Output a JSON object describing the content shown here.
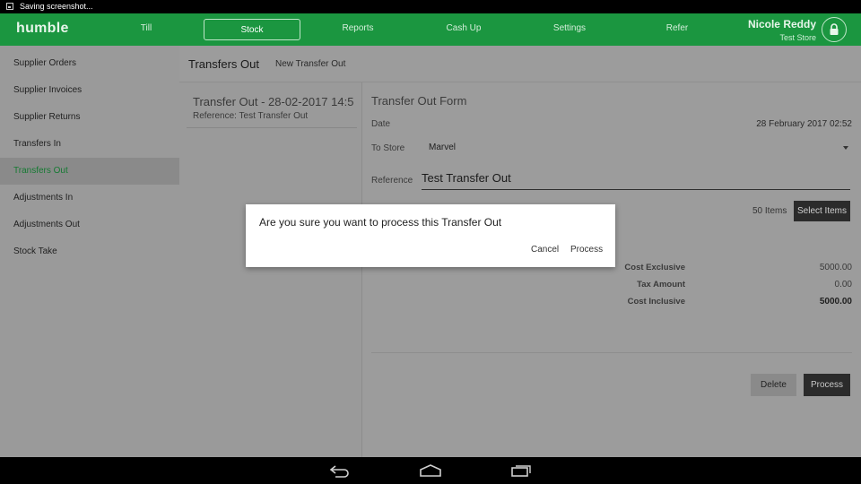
{
  "status_bar": {
    "text": "Saving screenshot..."
  },
  "topnav": {
    "brand": "humble",
    "items": [
      {
        "label": "Till"
      },
      {
        "label": "Stock"
      },
      {
        "label": "Reports"
      },
      {
        "label": "Cash Up"
      },
      {
        "label": "Settings"
      },
      {
        "label": "Refer"
      }
    ],
    "active": "Stock",
    "user_name": "Nicole Reddy",
    "store_name": "Test Store"
  },
  "sidebar": {
    "items": [
      {
        "label": "Supplier Orders"
      },
      {
        "label": "Supplier Invoices"
      },
      {
        "label": "Supplier Returns"
      },
      {
        "label": "Transfers In"
      },
      {
        "label": "Transfers Out"
      },
      {
        "label": "Adjustments In"
      },
      {
        "label": "Adjustments Out"
      },
      {
        "label": "Stock Take"
      }
    ],
    "active": "Transfers Out"
  },
  "main_header": {
    "title": "Transfers Out",
    "new_link": "New Transfer Out"
  },
  "list": {
    "items": [
      {
        "title": "Transfer Out - 28-02-2017 14:5",
        "reference": "Reference: Test Transfer Out"
      }
    ]
  },
  "form": {
    "title": "Transfer Out Form",
    "date_label": "Date",
    "date_value": "28 February 2017 02:52",
    "to_store_label": "To Store",
    "to_store_value": "Marvel",
    "reference_label": "Reference",
    "reference_value": "Test Transfer Out",
    "items_count": "50 Items",
    "select_items_label": "Select Items",
    "totals": {
      "cost_exclusive_label": "Cost Exclusive",
      "cost_exclusive_value": "5000.00",
      "tax_amount_label": "Tax Amount",
      "tax_amount_value": "0.00",
      "cost_inclusive_label": "Cost Inclusive",
      "cost_inclusive_value": "5000.00"
    },
    "delete_label": "Delete",
    "process_label": "Process"
  },
  "dialog": {
    "message": "Are you sure you want to process this Transfer Out",
    "cancel_label": "Cancel",
    "process_label": "Process"
  },
  "icons": {
    "status": "image-icon",
    "lock": "lock-icon",
    "back": "back-icon",
    "home": "home-icon",
    "recents": "recents-icon"
  },
  "colors": {
    "brand_green": "#1b9640",
    "active_text": "#167a33"
  }
}
